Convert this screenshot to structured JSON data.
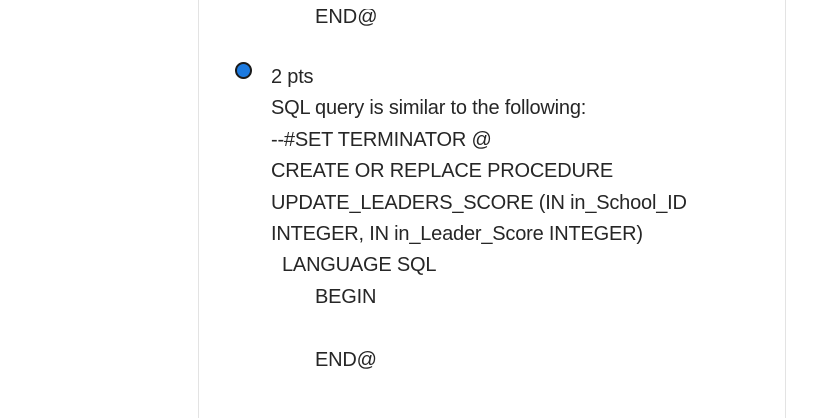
{
  "previous_option": {
    "tail_text": "END@"
  },
  "option": {
    "points": "2 pts",
    "description": "SQL query is similar to the following:",
    "code_lines": [
      "--#SET TERMINATOR @",
      "CREATE OR REPLACE PROCEDURE",
      "UPDATE_LEADERS_SCORE (IN in_School_ID",
      "INTEGER, IN in_Leader_Score INTEGER)",
      "LANGUAGE SQL",
      "BEGIN",
      "",
      "END@"
    ],
    "radio_color": "#1c7ae0"
  }
}
